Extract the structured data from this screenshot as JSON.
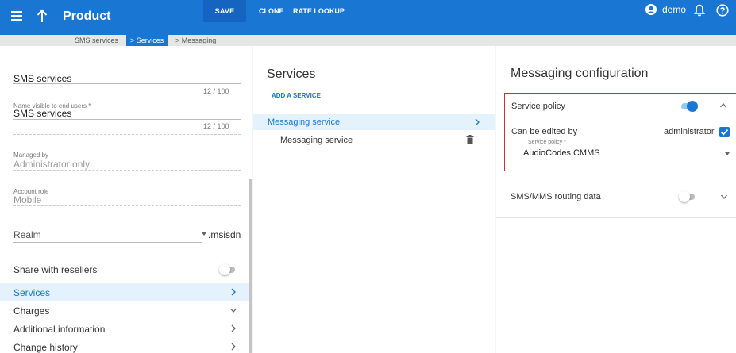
{
  "header": {
    "title": "Product",
    "save_label": "SAVE",
    "clone_label": "CLONE",
    "rate_lookup_label": "RATE LOOKUP",
    "username": "demo",
    "accent_color": "#1976d2"
  },
  "breadcrumb": {
    "items": [
      "SMS services",
      "Services",
      "Messaging"
    ]
  },
  "left": {
    "name_value": "SMS services",
    "name_counter": "12 / 100",
    "visible_name_label": "Name visible to end users *",
    "visible_name_value": "SMS services",
    "visible_name_counter": "12 / 100",
    "managed_by_label": "Managed by",
    "managed_by_value": "Administrator only",
    "account_role_label": "Account role",
    "account_role_value": "Mobile",
    "realm_label": "Realm",
    "realm_suffix": ".msisdn",
    "share_label": "Share with resellers",
    "share_enabled": false,
    "nav": [
      {
        "label": "Services",
        "active": true,
        "chevron": "chevron-right"
      },
      {
        "label": "Charges",
        "active": false,
        "chevron": "chevron-down"
      },
      {
        "label": "Additional information",
        "active": false,
        "chevron": "chevron-right"
      },
      {
        "label": "Change history",
        "active": false,
        "chevron": "chevron-right"
      }
    ]
  },
  "middle": {
    "title": "Services",
    "add_label": "ADD A SERVICE",
    "service_name": "Messaging service",
    "sub_item": "Messaging service"
  },
  "right": {
    "title": "Messaging configuration",
    "service_policy_title": "Service policy",
    "service_policy_enabled": true,
    "editable_label": "Can be edited by",
    "editable_value": "administrator",
    "editable_checked": true,
    "policy_field_label": "Service policy *",
    "policy_field_value": "AudioCodes CMMS",
    "routing_title": "SMS/MMS routing data",
    "routing_enabled": false,
    "highlight_color": "#d32f2f"
  }
}
